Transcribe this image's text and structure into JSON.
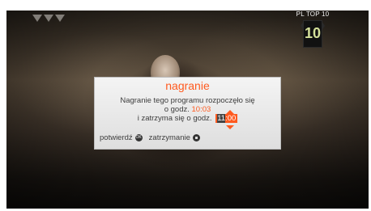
{
  "channel": {
    "top_label": "PL TOP 10",
    "badge_text": "10",
    "accent": "#d4e09a"
  },
  "dialog": {
    "title": "nagranie",
    "line1": "Nagranie tego programu rozpoczęło się",
    "line2_prefix": "o godz.",
    "start_time": "10:03",
    "line3_prefix": "i zatrzyma się o godz.",
    "end_time_edit": "11",
    "end_time_rest": ":00",
    "confirm_label": "potwierdź",
    "confirm_icon": "ok-button-icon",
    "stop_label": "zatrzymanie",
    "stop_icon": "stop-button-icon",
    "accent_color": "#ff5a1f"
  }
}
